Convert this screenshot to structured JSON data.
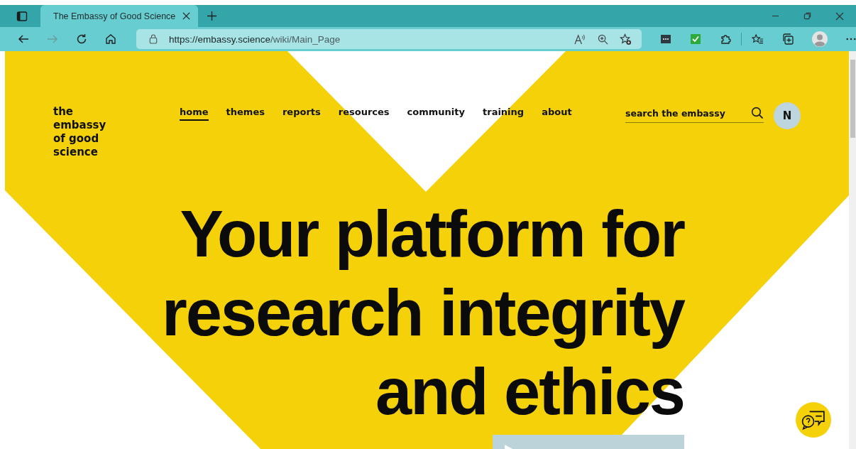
{
  "browser": {
    "tab": {
      "title": "The Embassy of Good Science",
      "selected": true
    },
    "url": {
      "host": "https://embassy.science",
      "path": "/wiki/Main_Page"
    }
  },
  "site": {
    "logo_lines": [
      "the",
      "embassy",
      "of good",
      "science"
    ],
    "nav": [
      {
        "label": "home",
        "selected": true
      },
      {
        "label": "themes",
        "selected": false
      },
      {
        "label": "reports",
        "selected": false
      },
      {
        "label": "resources",
        "selected": false
      },
      {
        "label": "community",
        "selected": false
      },
      {
        "label": "training",
        "selected": false
      },
      {
        "label": "about",
        "selected": false
      }
    ],
    "search": {
      "placeholder": "search the embassy"
    },
    "avatar": "N",
    "headline_lines": [
      "Your platform for",
      "research integrity",
      "and ethics"
    ]
  }
}
